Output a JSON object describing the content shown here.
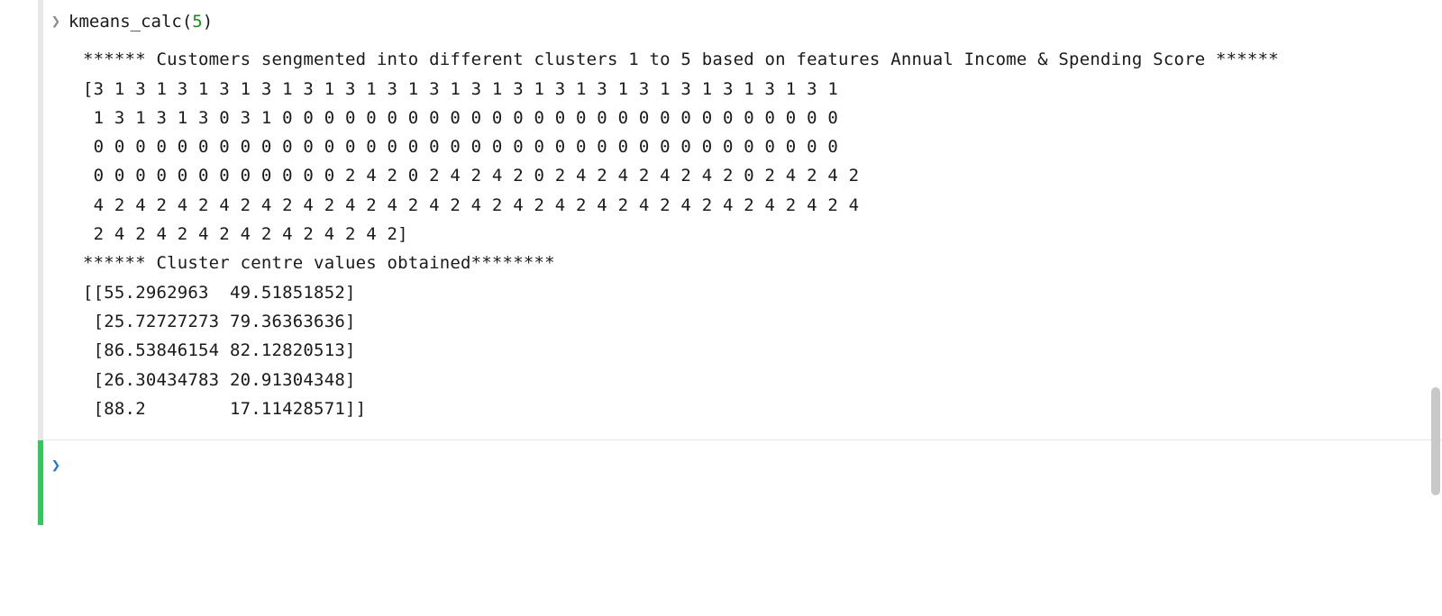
{
  "executed_cell": {
    "prompt_glyph": "❯",
    "code": {
      "func": "kmeans_calc",
      "open": "(",
      "arg": "5",
      "close": ")"
    },
    "output": "****** Customers sengmented into different clusters 1 to 5 based on features Annual Income & Spending Score ******\n[3 1 3 1 3 1 3 1 3 1 3 1 3 1 3 1 3 1 3 1 3 1 3 1 3 1 3 1 3 1 3 1 3 1 3 1\n 1 3 1 3 1 3 0 3 1 0 0 0 0 0 0 0 0 0 0 0 0 0 0 0 0 0 0 0 0 0 0 0 0 0 0 0\n 0 0 0 0 0 0 0 0 0 0 0 0 0 0 0 0 0 0 0 0 0 0 0 0 0 0 0 0 0 0 0 0 0 0 0 0\n 0 0 0 0 0 0 0 0 0 0 0 0 2 4 2 0 2 4 2 4 2 0 2 4 2 4 2 4 2 4 2 0 2 4 2 4 2\n 4 2 4 2 4 2 4 2 4 2 4 2 4 2 4 2 4 2 4 2 4 2 4 2 4 2 4 2 4 2 4 2 4 2 4 2 4\n 2 4 2 4 2 4 2 4 2 4 2 4 2 4 2]\n****** Cluster centre values obtained********\n[[55.2962963  49.51851852]\n [25.72727273 79.36363636]\n [86.53846154 82.12820513]\n [26.30434783 20.91304348]\n [88.2        17.11428571]]"
  },
  "new_cell": {
    "prompt_glyph": "❯",
    "value": ""
  }
}
